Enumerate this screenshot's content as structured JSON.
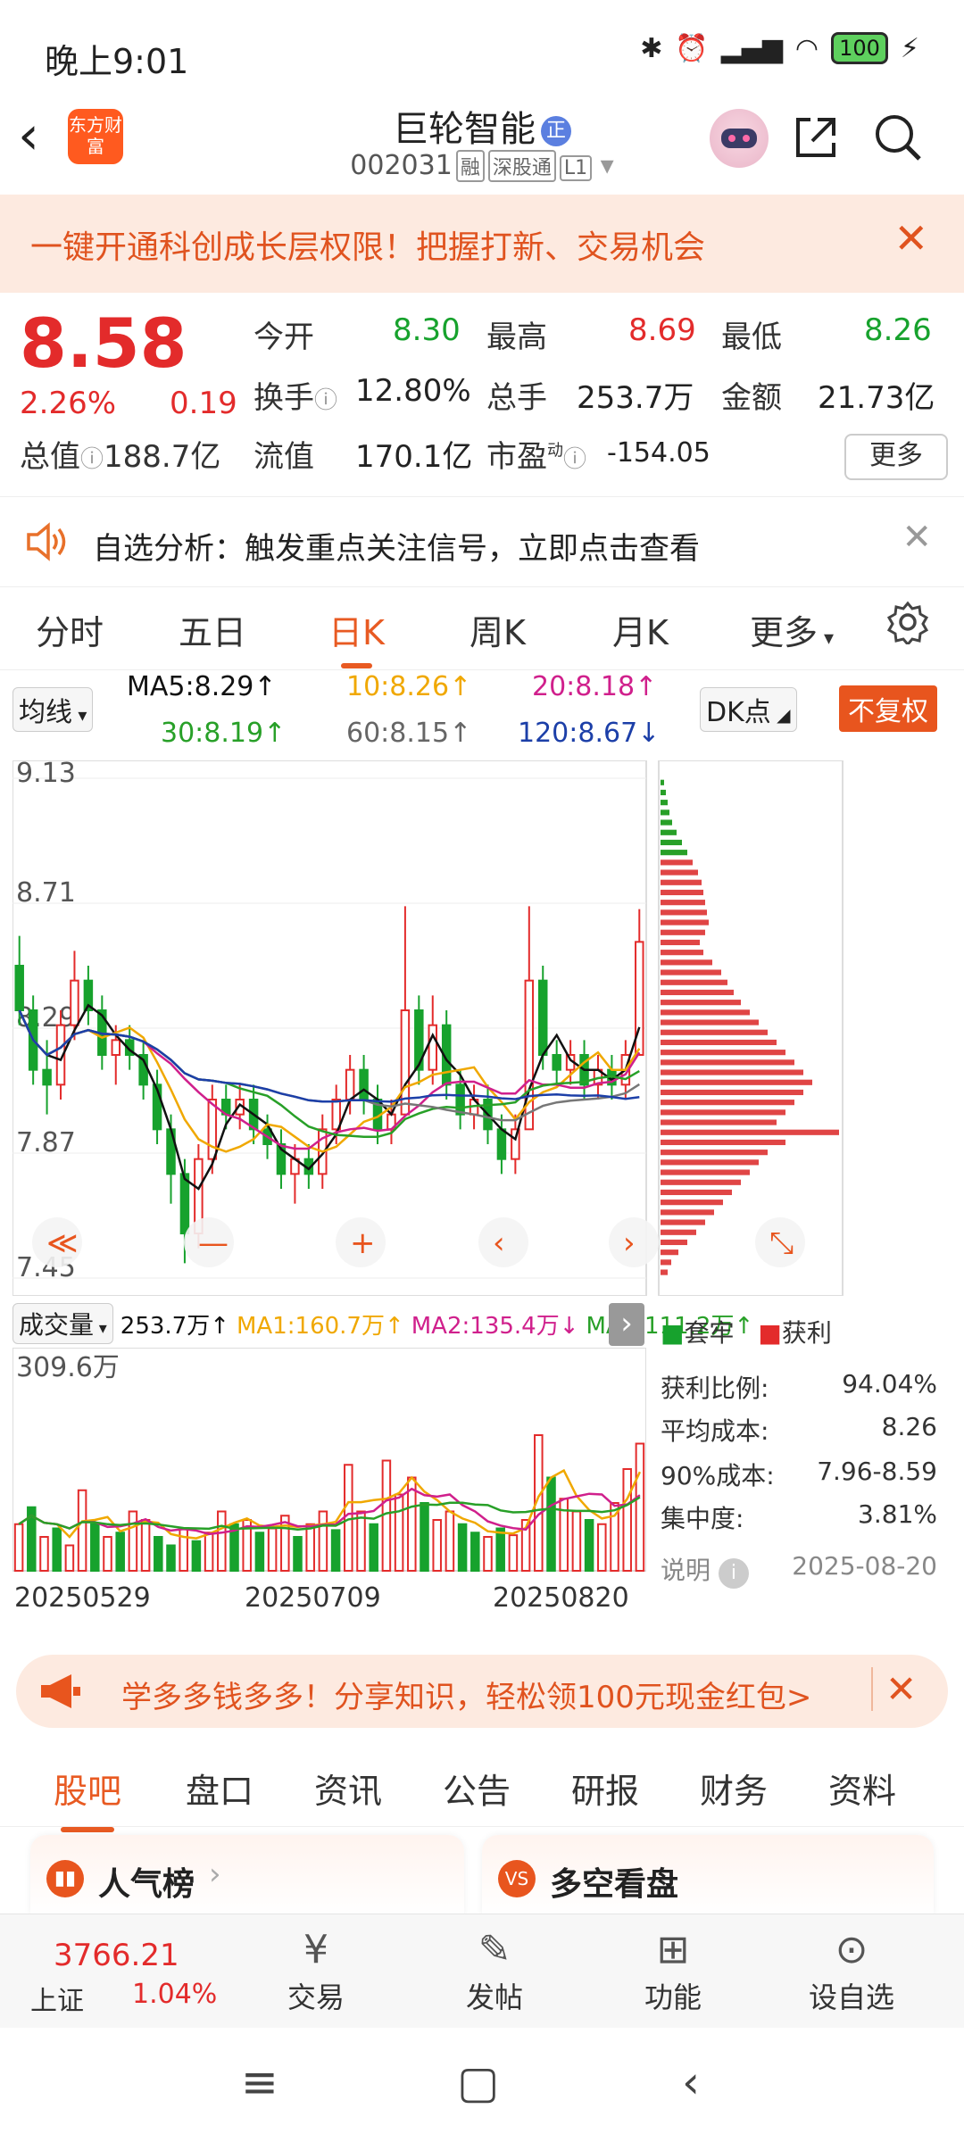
{
  "status": {
    "time": "晚上9:01",
    "battery": "100"
  },
  "header": {
    "logo_text": "东方财富",
    "stock_name": "巨轮智能",
    "badge": "正",
    "stock_code": "002031",
    "tags": [
      "融",
      "深股通",
      "L1"
    ]
  },
  "banner": {
    "text": "一键开通科创成长层权限！把握打新、交易机会"
  },
  "quote": {
    "price": "8.58",
    "change_pct": "2.26%",
    "change_amt": "0.19",
    "open_label": "今开",
    "open": "8.30",
    "high_label": "最高",
    "high": "8.69",
    "low_label": "最低",
    "low": "8.26",
    "turnover_label": "换手",
    "turnover": "12.80%",
    "volume_label": "总手",
    "volume": "253.7万",
    "amount_label": "金额",
    "amount": "21.73亿",
    "mcap_label": "总值",
    "mcap": "188.7亿",
    "float_label": "流值",
    "float": "170.1亿",
    "pe_label": "市盈",
    "pe_sup": "动",
    "pe": "-154.05",
    "more": "更多"
  },
  "alert": {
    "text": "自选分析：触发重点关注信号，立即点击查看"
  },
  "ktabs": [
    "分时",
    "五日",
    "日K",
    "周K",
    "月K",
    "更多"
  ],
  "ma": {
    "select": "均线",
    "ma5": "MA5:8.29↑",
    "ma10": "10:8.26↑",
    "ma20": "20:8.18↑",
    "ma30": "30:8.19↑",
    "ma60": "60:8.15↑",
    "ma120": "120:8.67↓",
    "dk": "DK点",
    "fuquan": "不复权"
  },
  "chart_data": {
    "type": "candlestick",
    "y_ticks": [
      "9.13",
      "8.71",
      "8.29",
      "7.87",
      "7.45"
    ],
    "ylim": [
      7.45,
      9.13
    ],
    "x_ticks": [
      "20250529",
      "20250709",
      "20250820"
    ],
    "colors": {
      "up": "#e32b2b",
      "down": "#17a22d",
      "ma5": "#111111",
      "ma10": "#f0a800",
      "ma20": "#d0208c",
      "ma30": "#28a028",
      "ma60": "#777777",
      "ma120": "#1c3fa8"
    },
    "candles": [
      [
        8.5,
        8.35,
        8.6,
        8.3
      ],
      [
        8.35,
        8.15,
        8.4,
        8.1
      ],
      [
        8.15,
        8.1,
        8.25,
        8.0
      ],
      [
        8.1,
        8.3,
        8.35,
        8.05
      ],
      [
        8.3,
        8.45,
        8.55,
        8.25
      ],
      [
        8.45,
        8.35,
        8.5,
        8.3
      ],
      [
        8.35,
        8.2,
        8.4,
        8.15
      ],
      [
        8.2,
        8.25,
        8.3,
        8.1
      ],
      [
        8.25,
        8.2,
        8.3,
        8.15
      ],
      [
        8.2,
        8.1,
        8.25,
        8.05
      ],
      [
        8.1,
        7.95,
        8.15,
        7.9
      ],
      [
        7.95,
        7.8,
        8.0,
        7.7
      ],
      [
        7.8,
        7.6,
        7.85,
        7.5
      ],
      [
        7.6,
        7.85,
        7.9,
        7.55
      ],
      [
        7.85,
        8.05,
        8.1,
        7.8
      ],
      [
        8.05,
        8.0,
        8.1,
        7.95
      ],
      [
        8.0,
        8.05,
        8.1,
        7.95
      ],
      [
        8.05,
        7.95,
        8.1,
        7.9
      ],
      [
        7.95,
        7.9,
        8.0,
        7.85
      ],
      [
        7.9,
        7.8,
        7.95,
        7.75
      ],
      [
        7.8,
        7.85,
        7.9,
        7.7
      ],
      [
        7.85,
        7.8,
        7.9,
        7.75
      ],
      [
        7.8,
        7.95,
        8.0,
        7.75
      ],
      [
        7.95,
        8.05,
        8.1,
        7.9
      ],
      [
        8.05,
        8.15,
        8.2,
        8.0
      ],
      [
        8.15,
        8.05,
        8.2,
        8.0
      ],
      [
        8.05,
        7.95,
        8.1,
        7.9
      ],
      [
        7.95,
        8.0,
        8.05,
        7.9
      ],
      [
        8.0,
        8.35,
        8.7,
        8.0
      ],
      [
        8.35,
        8.15,
        8.4,
        8.1
      ],
      [
        8.15,
        8.3,
        8.4,
        8.1
      ],
      [
        8.3,
        8.1,
        8.35,
        8.05
      ],
      [
        8.1,
        8.0,
        8.15,
        7.95
      ],
      [
        8.0,
        8.05,
        8.1,
        7.95
      ],
      [
        8.05,
        7.95,
        8.1,
        7.9
      ],
      [
        7.95,
        7.85,
        8.0,
        7.8
      ],
      [
        7.85,
        7.95,
        8.0,
        7.8
      ],
      [
        7.95,
        8.45,
        8.7,
        7.95
      ],
      [
        8.45,
        8.2,
        8.5,
        8.15
      ],
      [
        8.2,
        8.15,
        8.25,
        8.1
      ],
      [
        8.15,
        8.2,
        8.25,
        8.1
      ],
      [
        8.2,
        8.1,
        8.25,
        8.05
      ],
      [
        8.1,
        8.15,
        8.2,
        8.05
      ],
      [
        8.15,
        8.1,
        8.2,
        8.05
      ],
      [
        8.1,
        8.2,
        8.25,
        8.05
      ],
      [
        8.2,
        8.58,
        8.69,
        8.26
      ]
    ],
    "price_bars": [
      4,
      6,
      8,
      10,
      13,
      18,
      24,
      30,
      36,
      42,
      46,
      48,
      50,
      52,
      54,
      50,
      44,
      48,
      58,
      68,
      75,
      82,
      90,
      100,
      110,
      120,
      130,
      140,
      150,
      160,
      170,
      160,
      150,
      140,
      130,
      200,
      140,
      120,
      110,
      100,
      90,
      80,
      70,
      60,
      50,
      40,
      30,
      20,
      12,
      8
    ],
    "volume_max_label": "309.6万",
    "volume": [
      55,
      75,
      40,
      50,
      30,
      95,
      55,
      40,
      45,
      70,
      60,
      40,
      30,
      50,
      35,
      45,
      70,
      55,
      60,
      45,
      50,
      65,
      40,
      55,
      70,
      48,
      125,
      70,
      55,
      130,
      90,
      110,
      80,
      60,
      70,
      55,
      45,
      40,
      50,
      42,
      60,
      160,
      110,
      85,
      70,
      60,
      55,
      80,
      120,
      150
    ],
    "volume_up": [
      true,
      false,
      true,
      false,
      true,
      true,
      false,
      true,
      false,
      true,
      true,
      false,
      false,
      true,
      false,
      true,
      true,
      false,
      true,
      false,
      true,
      true,
      false,
      true,
      true,
      false,
      true,
      true,
      false,
      true,
      true,
      true,
      false,
      true,
      true,
      false,
      false,
      true,
      false,
      true,
      true,
      true,
      false,
      true,
      true,
      false,
      true,
      true,
      true,
      true
    ]
  },
  "vol_legend": {
    "select": "成交量",
    "vol": "253.7万↑",
    "ma1": "MA1:160.7万↑",
    "ma2": "MA2:135.4万↓",
    "ma3": "MA3:111.2万↑"
  },
  "chip": {
    "legend_trap": "套牢",
    "legend_profit": "获利",
    "profit_ratio_label": "获利比例:",
    "profit_ratio": "94.04%",
    "avg_cost_label": "平均成本:",
    "avg_cost": "8.26",
    "cost90_label": "90%成本:",
    "cost90": "7.96-8.59",
    "conc_label": "集中度:",
    "conc": "3.81%",
    "note_label": "说明",
    "date": "2025-08-20"
  },
  "promo": {
    "text": "学多多钱多多！分享知识，轻松领100元现金红包>"
  },
  "btabs": [
    "股吧",
    "盘口",
    "资讯",
    "公告",
    "研报",
    "财务",
    "资料"
  ],
  "cards": {
    "left": "人气榜",
    "right": "多空看盘"
  },
  "bnav": {
    "index_value": "3766.21",
    "index_name": "上证",
    "index_pct": "1.04%",
    "trade": "交易",
    "post": "发帖",
    "func": "功能",
    "watch": "设自选"
  }
}
